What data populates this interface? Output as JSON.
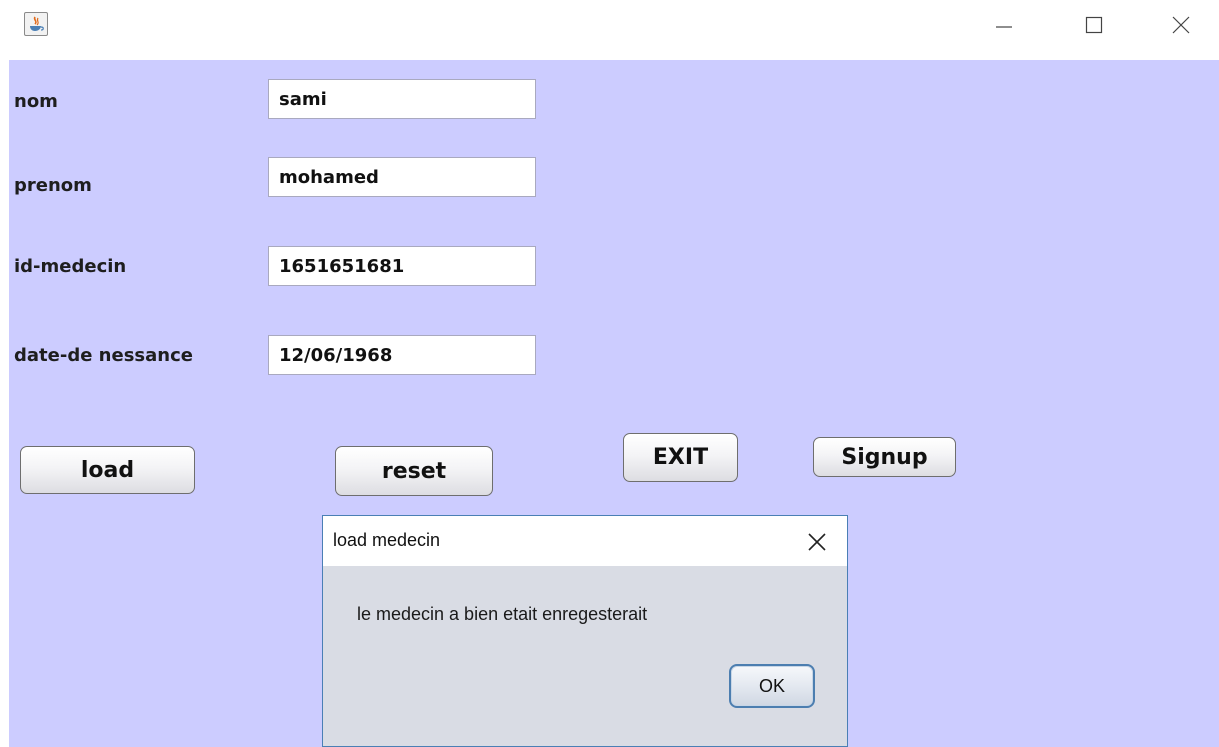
{
  "window": {
    "title": "",
    "icons": [
      "java-app-icon",
      "minimize-icon",
      "maximize-icon",
      "close-icon"
    ]
  },
  "form": {
    "fields": [
      {
        "label": "nom",
        "value": "sami"
      },
      {
        "label": "prenom",
        "value": "mohamed"
      },
      {
        "label": "id-medecin",
        "value": "1651651681"
      },
      {
        "label": "date-de nessance",
        "value": "12/06/1968"
      }
    ],
    "buttons": {
      "load": "load",
      "reset": "reset",
      "exit": "EXIT",
      "signup": "Signup"
    }
  },
  "dialog": {
    "title": "load medecin",
    "message": "le medecin a bien etait enregesterait",
    "ok_label": "OK"
  },
  "colors": {
    "panel_background": "#ccccff",
    "dialog_background": "#d9dce4",
    "dialog_border": "#4a7fb5"
  }
}
